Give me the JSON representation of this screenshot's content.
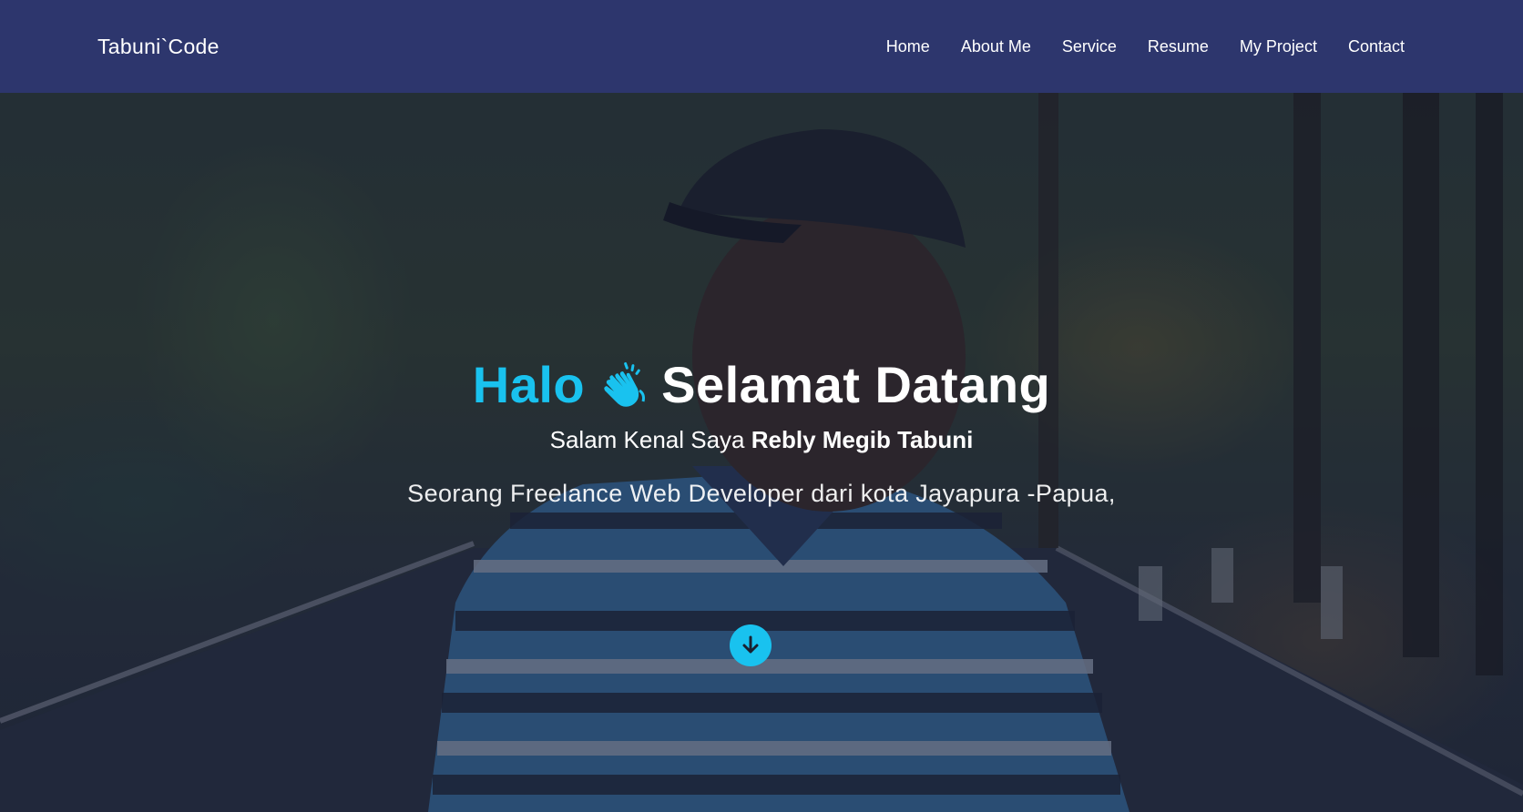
{
  "navbar": {
    "brand": "Tabuni`Code",
    "items": [
      {
        "label": "Home"
      },
      {
        "label": "About Me"
      },
      {
        "label": "Service"
      },
      {
        "label": "Resume"
      },
      {
        "label": "My Project"
      },
      {
        "label": "Contact"
      }
    ]
  },
  "hero": {
    "title_accent": "Halo",
    "title_icon": "waving-hand-icon",
    "title_rest": "Selamat Datang",
    "subtitle_prefix": "Salam Kenal Saya",
    "subtitle_name": "Rebly Megib Tabuni",
    "tagline": "Seorang Freelance Web Developer dari kota Jayapura -Papua,",
    "scroll_icon": "arrow-down-circle-icon"
  },
  "colors": {
    "navbar_bg": "#2d366d",
    "accent": "#19c2ef",
    "text": "#ffffff"
  }
}
